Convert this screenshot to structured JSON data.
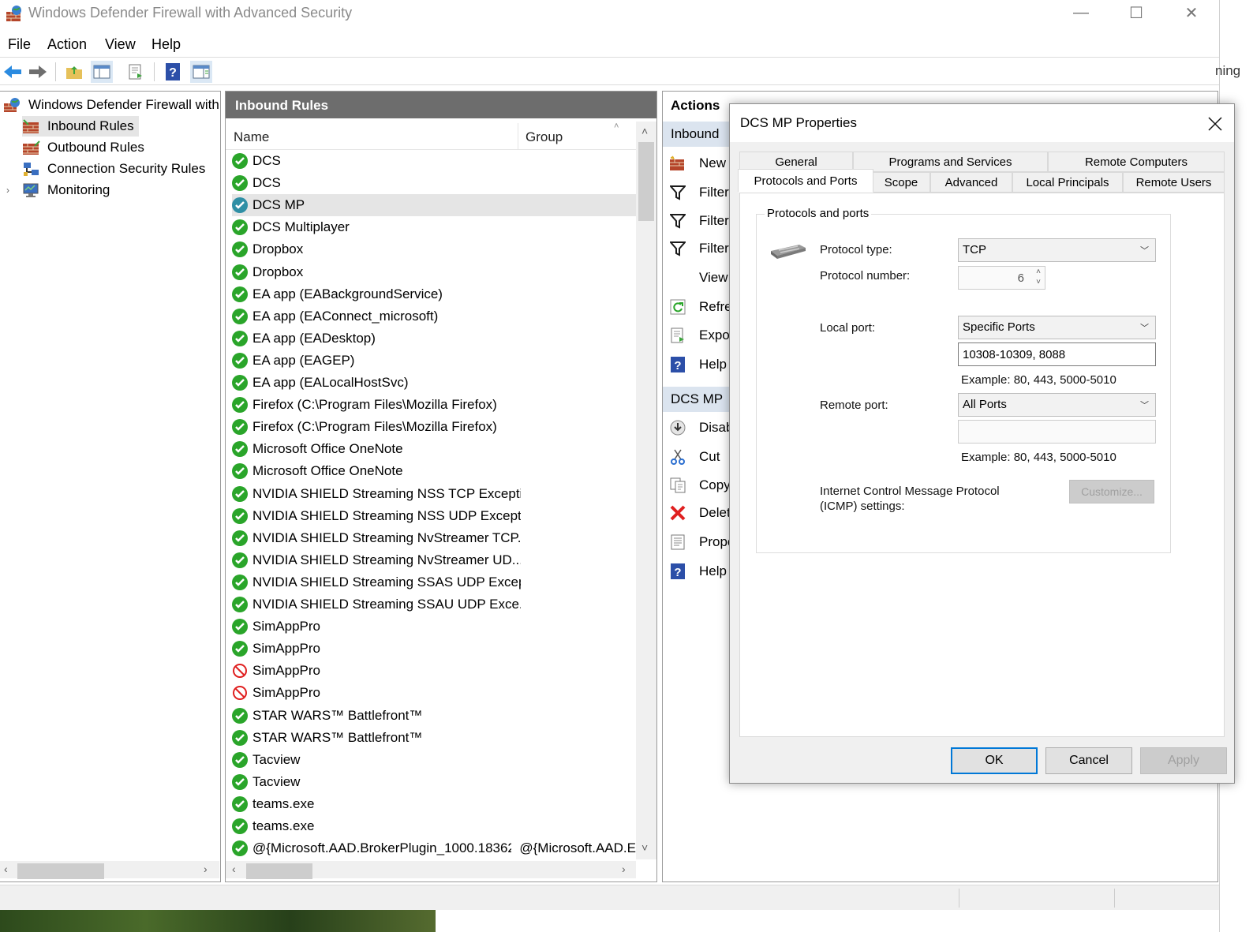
{
  "window": {
    "title": "Windows Defender Firewall with Advanced Security",
    "minimize": "—",
    "maximize": "☐",
    "close": "✕"
  },
  "menu": [
    "File",
    "Action",
    "View",
    "Help"
  ],
  "tree": {
    "root": "Windows Defender Firewall with",
    "items": [
      "Inbound Rules",
      "Outbound Rules",
      "Connection Security Rules",
      "Monitoring"
    ]
  },
  "rules_pane": {
    "header": "Inbound Rules",
    "col_name": "Name",
    "col_group": "Group",
    "rows": [
      {
        "name": "DCS",
        "group": "",
        "status": "allow"
      },
      {
        "name": "DCS",
        "group": "",
        "status": "allow"
      },
      {
        "name": "DCS  MP",
        "group": "",
        "status": "allow-selected"
      },
      {
        "name": "DCS Multiplayer",
        "group": "",
        "status": "allow"
      },
      {
        "name": "Dropbox",
        "group": "",
        "status": "allow"
      },
      {
        "name": "Dropbox",
        "group": "",
        "status": "allow"
      },
      {
        "name": "EA app (EABackgroundService)",
        "group": "",
        "status": "allow"
      },
      {
        "name": "EA app (EAConnect_microsoft)",
        "group": "",
        "status": "allow"
      },
      {
        "name": "EA app (EADesktop)",
        "group": "",
        "status": "allow"
      },
      {
        "name": "EA app (EAGEP)",
        "group": "",
        "status": "allow"
      },
      {
        "name": "EA app (EALocalHostSvc)",
        "group": "",
        "status": "allow"
      },
      {
        "name": "Firefox (C:\\Program Files\\Mozilla Firefox)",
        "group": "",
        "status": "allow"
      },
      {
        "name": "Firefox (C:\\Program Files\\Mozilla Firefox)",
        "group": "",
        "status": "allow"
      },
      {
        "name": "Microsoft Office OneNote",
        "group": "",
        "status": "allow"
      },
      {
        "name": "Microsoft Office OneNote",
        "group": "",
        "status": "allow"
      },
      {
        "name": "NVIDIA SHIELD Streaming NSS TCP Excepti...",
        "group": "",
        "status": "allow"
      },
      {
        "name": "NVIDIA SHIELD Streaming NSS UDP Except...",
        "group": "",
        "status": "allow"
      },
      {
        "name": "NVIDIA SHIELD Streaming NvStreamer TCP...",
        "group": "",
        "status": "allow"
      },
      {
        "name": "NVIDIA SHIELD Streaming NvStreamer UD...",
        "group": "",
        "status": "allow"
      },
      {
        "name": "NVIDIA SHIELD Streaming SSAS UDP Excep...",
        "group": "",
        "status": "allow"
      },
      {
        "name": "NVIDIA SHIELD Streaming SSAU UDP Exce...",
        "group": "",
        "status": "allow"
      },
      {
        "name": "SimAppPro",
        "group": "",
        "status": "allow"
      },
      {
        "name": "SimAppPro",
        "group": "",
        "status": "allow"
      },
      {
        "name": "SimAppPro",
        "group": "",
        "status": "block"
      },
      {
        "name": "SimAppPro",
        "group": "",
        "status": "block"
      },
      {
        "name": "STAR WARS™ Battlefront™",
        "group": "",
        "status": "allow"
      },
      {
        "name": "STAR WARS™ Battlefront™",
        "group": "",
        "status": "allow"
      },
      {
        "name": "Tacview",
        "group": "",
        "status": "allow"
      },
      {
        "name": "Tacview",
        "group": "",
        "status": "allow"
      },
      {
        "name": "teams.exe",
        "group": "",
        "status": "allow"
      },
      {
        "name": "teams.exe",
        "group": "",
        "status": "allow"
      },
      {
        "name": "@{Microsoft.AAD.BrokerPlugin_1000.18362...",
        "group": "@{Microsoft.AAD.E",
        "status": "allow"
      }
    ]
  },
  "actions_pane": {
    "header": "Actions",
    "section1": "Inbound",
    "section1_items": [
      "New",
      "Filter",
      "Filter",
      "Filter",
      "View",
      "Refre",
      "Expo",
      "Help"
    ],
    "section2": "DCS  MP",
    "section2_items": [
      "Disab",
      "Cut",
      "Copy",
      "Delet",
      "Prope",
      "Help"
    ]
  },
  "right_edge_text": "ning",
  "dialog": {
    "title": "DCS  MP Properties",
    "tabs_row1": [
      "General",
      "Programs and Services",
      "Remote Computers"
    ],
    "tabs_row2": [
      "Protocols and Ports",
      "Scope",
      "Advanced",
      "Local Principals",
      "Remote Users"
    ],
    "active_tab": "Protocols and Ports",
    "group_title": "Protocols and ports",
    "protocol_type_label": "Protocol type:",
    "protocol_type_value": "TCP",
    "protocol_number_label": "Protocol number:",
    "protocol_number_value": "6",
    "local_port_label": "Local port:",
    "local_port_mode": "Specific Ports",
    "local_port_value": "10308-10309, 8088",
    "local_example": "Example: 80, 443, 5000-5010",
    "remote_port_label": "Remote port:",
    "remote_port_mode": "All Ports",
    "remote_port_value": "",
    "remote_example": "Example: 80, 443, 5000-5010",
    "icmp_label_1": "Internet Control Message Protocol",
    "icmp_label_2": "(ICMP) settings:",
    "customize": "Customize...",
    "ok": "OK",
    "cancel": "Cancel",
    "apply": "Apply"
  },
  "colors": {
    "allow": "#2aa52a",
    "selected_allow": "#2f8fa5",
    "block": "#e02020",
    "header_bg": "#6d6d6d",
    "accent": "#0078d7"
  }
}
